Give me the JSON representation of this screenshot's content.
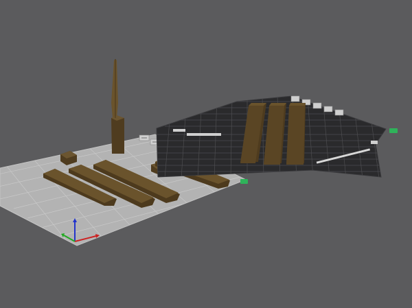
{
  "scene": {
    "background_color": "#5b5b5d",
    "model_color": "#5a4524",
    "left_plate": {
      "color": "#b3b3b3",
      "corner_badge_icon": "plate-corner-badge-icon",
      "toolbar_icons": [
        "plate-arrange-icon",
        "plate-orient-icon",
        "plate-lock-icon",
        "plate-settings-icon",
        "plate-edit-icon"
      ],
      "objects": [
        "spire",
        "small-block",
        "bracket",
        "plank-1",
        "plank-2",
        "plank-3",
        "plank-4"
      ]
    },
    "right_plate": {
      "color": "#2a2a2c",
      "grid_color": "#4d4d50",
      "corner_badge_icon": "plate-corner-badge-icon",
      "toolbar_icons": [
        "plate-arrange-icon",
        "plate-orient-icon",
        "plate-lock-icon",
        "plate-settings-icon",
        "plate-edit-icon"
      ],
      "objects": [
        "plank-1",
        "plank-2",
        "plank-3"
      ]
    },
    "axes": {
      "x_color": "#cc2222",
      "y_color": "#22aa22",
      "z_color": "#2233cc"
    }
  }
}
